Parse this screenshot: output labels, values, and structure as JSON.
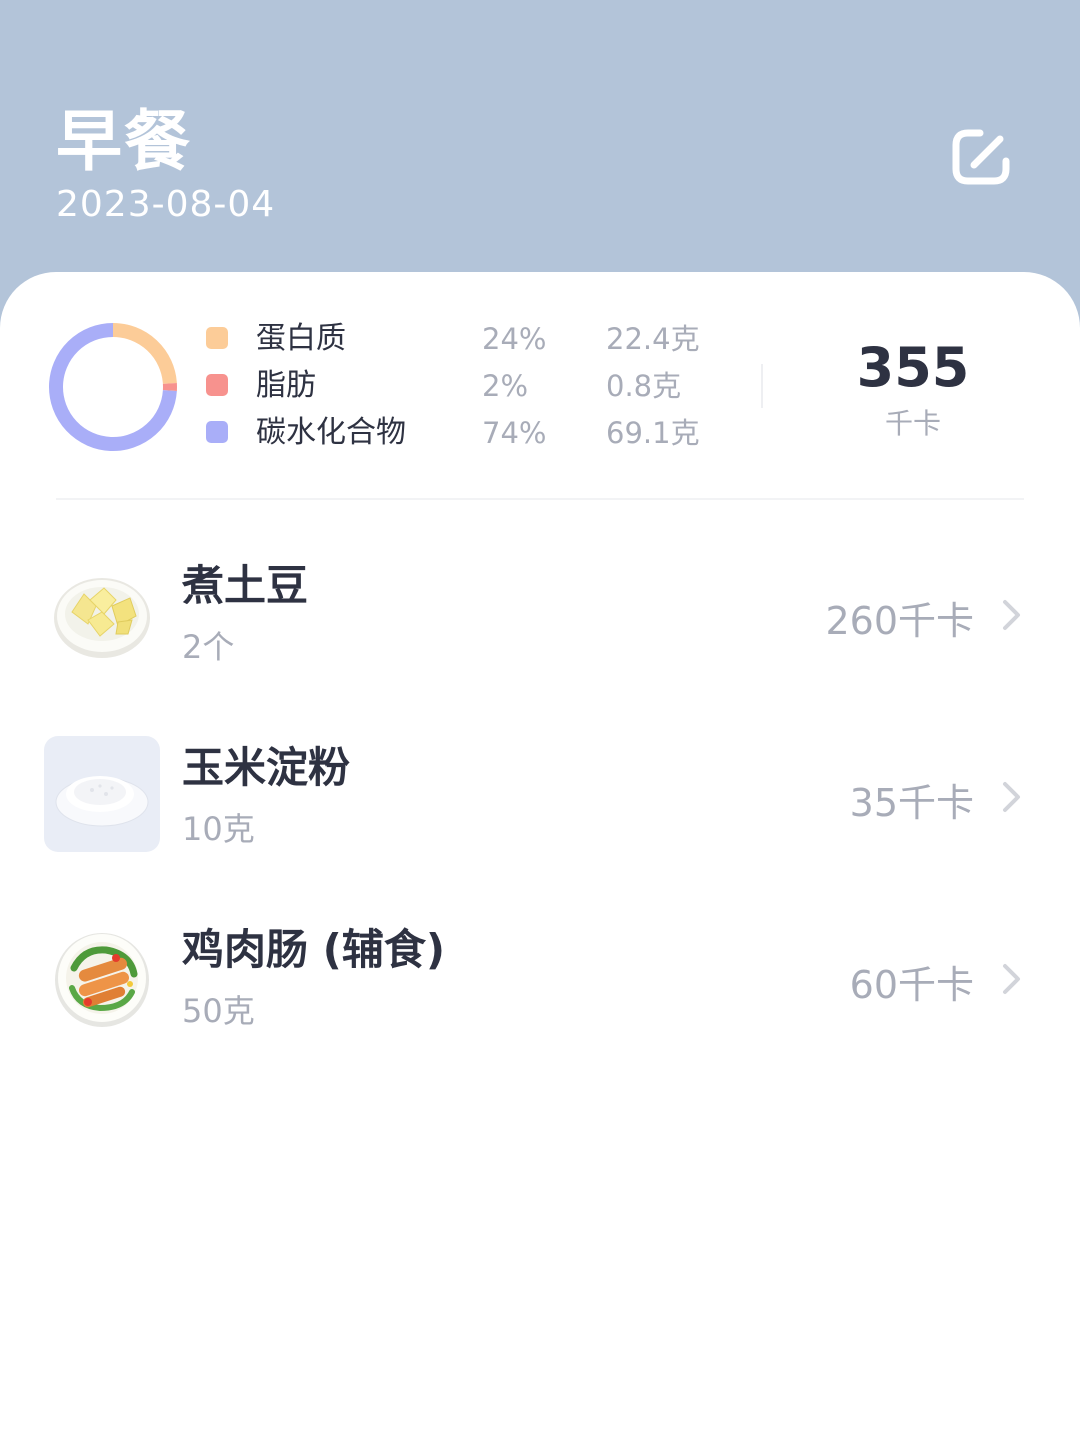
{
  "header": {
    "title": "早餐",
    "date": "2023-08-04",
    "edit_icon": "edit-square-icon"
  },
  "summary": {
    "nutrients": [
      {
        "name": "蛋白质",
        "percent": "24%",
        "amount": "22.4克",
        "color": "#fccc98"
      },
      {
        "name": "脂肪",
        "percent": "2%",
        "amount": "0.8克",
        "color": "#f7928e"
      },
      {
        "name": "碳水化合物",
        "percent": "74%",
        "amount": "69.1克",
        "color": "#a9aef8"
      }
    ],
    "total_kcal": "355",
    "kcal_unit": "千卡"
  },
  "chart_data": {
    "type": "pie",
    "categories": [
      "蛋白质",
      "脂肪",
      "碳水化合物"
    ],
    "values": [
      24,
      2,
      74
    ],
    "colors": [
      "#fccc98",
      "#f7928e",
      "#a9aef8"
    ]
  },
  "foods": [
    {
      "name": "煮土豆",
      "qty": "2个",
      "kcal": "260千卡",
      "thumb": "boiled-potato"
    },
    {
      "name": "玉米淀粉",
      "qty": "10克",
      "kcal": "35千卡",
      "thumb": "corn-starch"
    },
    {
      "name": "鸡肉肠 (辅食)",
      "qty": "50克",
      "kcal": "60千卡",
      "thumb": "chicken-sausage"
    }
  ]
}
